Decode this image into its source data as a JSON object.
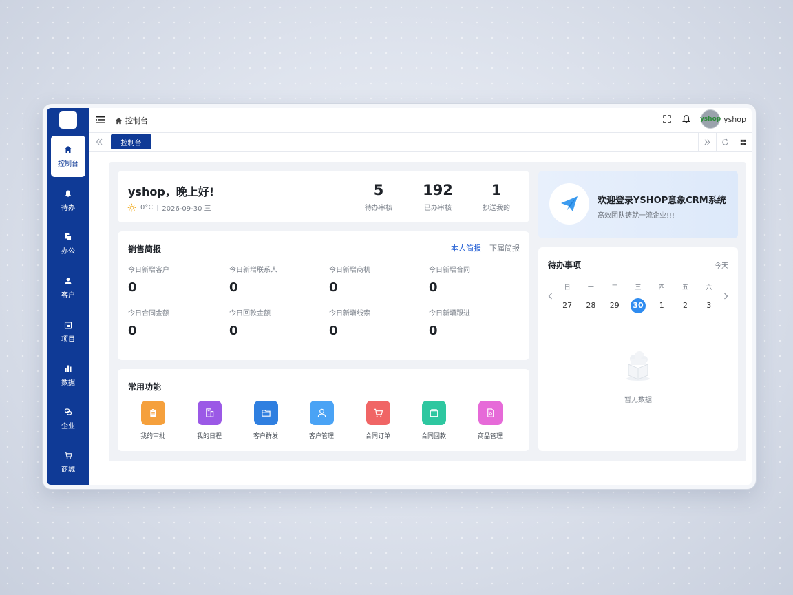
{
  "header": {
    "breadcrumb": "控制台",
    "username": "yshop",
    "avatar_text": "yshop"
  },
  "sidebar": {
    "items": [
      {
        "label": "控制台",
        "icon": "home-icon",
        "active": true
      },
      {
        "label": "待办",
        "icon": "bell-icon"
      },
      {
        "label": "办公",
        "icon": "copy-icon"
      },
      {
        "label": "客户",
        "icon": "user-icon"
      },
      {
        "label": "项目",
        "icon": "calendar-icon"
      },
      {
        "label": "数据",
        "icon": "bar-chart-icon"
      },
      {
        "label": "企业",
        "icon": "link-icon"
      },
      {
        "label": "商城",
        "icon": "cart-icon"
      }
    ]
  },
  "tabs": {
    "active": "控制台"
  },
  "greeting": {
    "title": "yshop，晚上好!",
    "temperature": "0°C",
    "date": "2026-09-30 三",
    "stats": [
      {
        "value": "5",
        "label": "待办审核"
      },
      {
        "value": "192",
        "label": "已办审核"
      },
      {
        "value": "1",
        "label": "抄送我的"
      }
    ]
  },
  "sales": {
    "title": "销售简报",
    "tab_self": "本人简报",
    "tab_sub": "下属简报",
    "metrics": [
      {
        "label": "今日新增客户",
        "value": "0"
      },
      {
        "label": "今日新增联系人",
        "value": "0"
      },
      {
        "label": "今日新增商机",
        "value": "0"
      },
      {
        "label": "今日新增合同",
        "value": "0"
      },
      {
        "label": "今日合同金额",
        "value": "0"
      },
      {
        "label": "今日回款金额",
        "value": "0"
      },
      {
        "label": "今日新增线索",
        "value": "0"
      },
      {
        "label": "今日新增跟进",
        "value": "0"
      }
    ]
  },
  "functions": {
    "title": "常用功能",
    "items": [
      {
        "label": "我的审批",
        "color": "#f5a03c",
        "icon": "clipboard-icon"
      },
      {
        "label": "我的日程",
        "color": "#9b59e6",
        "icon": "building-icon"
      },
      {
        "label": "客户群发",
        "color": "#2f7fe0",
        "icon": "folder-icon"
      },
      {
        "label": "客户管理",
        "color": "#4aa3f5",
        "icon": "person-icon"
      },
      {
        "label": "合同订单",
        "color": "#f06565",
        "icon": "cart-icon"
      },
      {
        "label": "合同回款",
        "color": "#2ec7a0",
        "icon": "wallet-icon"
      },
      {
        "label": "商品管理",
        "color": "#e66ad8",
        "icon": "document-icon"
      }
    ]
  },
  "welcome": {
    "title": "欢迎登录YSHOP意象CRM系统",
    "subtitle": "高效团队铸就一流企业!!!"
  },
  "todo": {
    "title": "待办事项",
    "today": "今天",
    "weekdays": [
      "日",
      "一",
      "二",
      "三",
      "四",
      "五",
      "六"
    ],
    "days": [
      "27",
      "28",
      "29",
      "30",
      "1",
      "2",
      "3"
    ],
    "selected_index": 3,
    "empty_text": "暂无数据"
  },
  "colors": {
    "brand": "#0f3a96",
    "accent": "#2f8cf0"
  }
}
